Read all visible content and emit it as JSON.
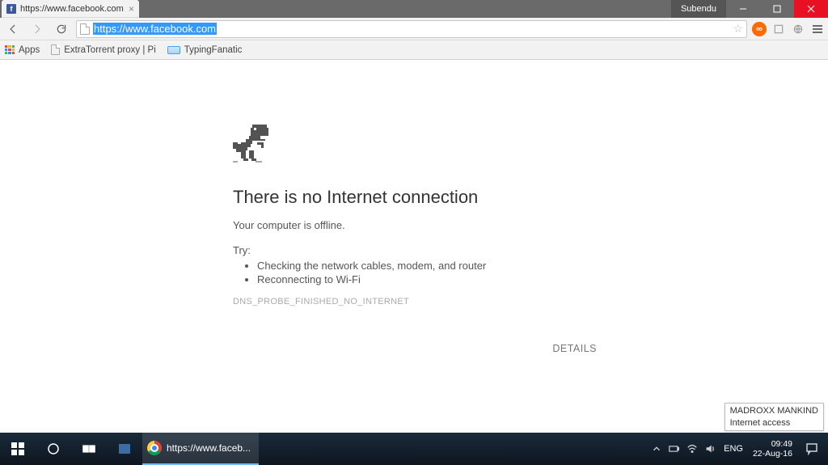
{
  "window": {
    "user": "Subendu"
  },
  "tab": {
    "title": "https://www.facebook.com",
    "favicon_letter": "f"
  },
  "omnibox": {
    "url": "https://www.facebook.com"
  },
  "bookmarks": {
    "apps": "Apps",
    "items": [
      "ExtraTorrent proxy | Pi",
      "TypingFanatic"
    ]
  },
  "error": {
    "heading": "There is no Internet connection",
    "subheading": "Your computer is offline.",
    "try_label": "Try:",
    "suggestions": [
      "Checking the network cables, modem, and router",
      "Reconnecting to Wi-Fi"
    ],
    "code": "DNS_PROBE_FINISHED_NO_INTERNET",
    "details": "DETAILS"
  },
  "tooltip": {
    "line1": "MADROXX MANKIND",
    "line2": "Internet access"
  },
  "taskbar": {
    "chrome_title": "https://www.faceb...",
    "lang": "ENG",
    "time": "09:49",
    "date": "22-Aug-16"
  }
}
